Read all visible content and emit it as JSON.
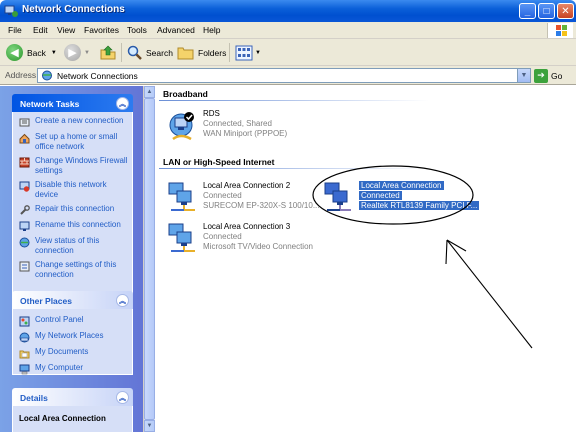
{
  "window": {
    "title": "Network Connections",
    "minimize_label": "_",
    "maximize_label": "□",
    "close_label": "✕"
  },
  "menu": {
    "items": [
      "File",
      "Edit",
      "View",
      "Favorites",
      "Tools",
      "Advanced",
      "Help"
    ]
  },
  "toolbar": {
    "back_label": "Back",
    "search_label": "Search",
    "folders_label": "Folders"
  },
  "address": {
    "label": "Address",
    "value": "Network Connections",
    "go_label": "Go"
  },
  "sidebar": {
    "network_tasks": {
      "title": "Network Tasks",
      "items": [
        {
          "label": "Create a new connection",
          "icon": "new-connection-icon"
        },
        {
          "label": "Set up a home or small office network",
          "icon": "home-network-icon"
        },
        {
          "label": "Change Windows Firewall settings",
          "icon": "firewall-icon"
        },
        {
          "label": "Disable this network device",
          "icon": "disable-icon"
        },
        {
          "label": "Repair this connection",
          "icon": "repair-icon"
        },
        {
          "label": "Rename this connection",
          "icon": "rename-icon"
        },
        {
          "label": "View status of this connection",
          "icon": "status-icon"
        },
        {
          "label": "Change settings of this connection",
          "icon": "settings-icon"
        }
      ]
    },
    "other_places": {
      "title": "Other Places",
      "items": [
        {
          "label": "Control Panel",
          "icon": "control-panel-icon"
        },
        {
          "label": "My Network Places",
          "icon": "network-places-icon"
        },
        {
          "label": "My Documents",
          "icon": "documents-icon"
        },
        {
          "label": "My Computer",
          "icon": "computer-icon"
        }
      ]
    },
    "details": {
      "title": "Details",
      "selected_name": "Local Area Connection"
    }
  },
  "main": {
    "groups": [
      {
        "title": "Broadband"
      },
      {
        "title": "LAN or High-Speed Internet"
      }
    ],
    "connections": {
      "rds": {
        "name": "RDS",
        "status": "Connected, Shared",
        "device": "WAN Miniport (PPPOE)"
      },
      "lac2": {
        "name": "Local Area Connection 2",
        "status": "Connected",
        "device": "SURECOM EP-320X-S 100/10..."
      },
      "lac": {
        "name": "Local Area Connection",
        "status": "Connected",
        "device": "Realtek RTL8139 Family PCI F..."
      },
      "lac3": {
        "name": "Local Area Connection 3",
        "status": "Connected",
        "device": "Microsoft TV/Video Connection"
      }
    }
  },
  "colors": {
    "titlebar": "#0a56d6",
    "sidebar": "#6375d6",
    "selection": "#316ac5",
    "link": "#215dc6"
  }
}
